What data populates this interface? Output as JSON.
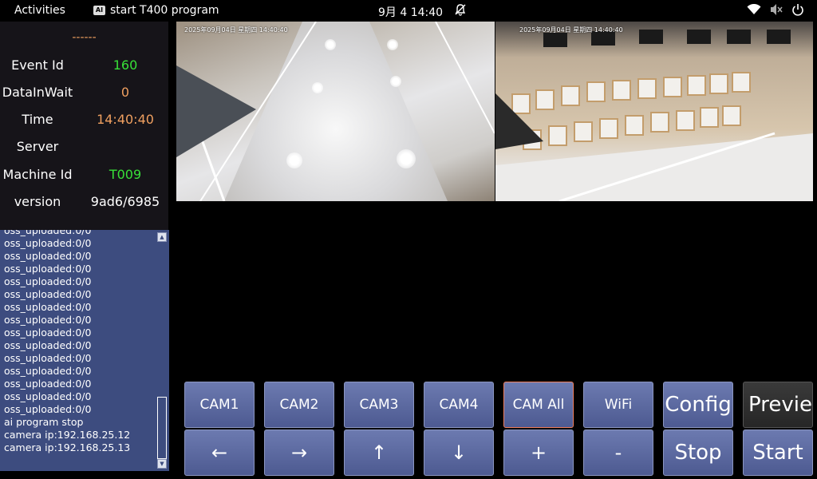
{
  "topbar": {
    "activities": "Activities",
    "app_icon": "AI",
    "app_title": "start T400 program",
    "clock": "9月 4  14:40",
    "tray_icons": [
      "wifi-icon",
      "volume-muted-icon",
      "power-icon"
    ],
    "bell_icon": "bell-muted-icon"
  },
  "info": {
    "dashes": "------",
    "rows": [
      {
        "label": "Event Id",
        "value": "160",
        "color": "#38e038"
      },
      {
        "label": "DataInWait",
        "value": "0",
        "color": "#f0a060"
      },
      {
        "label": "Time",
        "value": "14:40:40",
        "color": "#f0a060"
      },
      {
        "label": "Server",
        "value": "",
        "color": "#ffffff"
      },
      {
        "label": "Machine Id",
        "value": "T009",
        "color": "#38e038"
      },
      {
        "label": "version",
        "value": "9ad6/6985",
        "color": "#ffffff"
      }
    ]
  },
  "log": {
    "lines": [
      "oss_uploaded:0/0",
      "oss_uploaded:0/0",
      "oss_uploaded:0/0",
      "oss_uploaded:0/0",
      "oss_uploaded:0/0",
      "oss_uploaded:0/0",
      "oss_uploaded:0/0",
      "oss_uploaded:0/0",
      "oss_uploaded:0/0",
      "oss_uploaded:0/0",
      "oss_uploaded:0/0",
      "oss_uploaded:0/0",
      "oss_uploaded:0/0",
      "oss_uploaded:0/0",
      "oss_uploaded:0/0",
      "ai program stop",
      "camera ip:192.168.25.12",
      "camera ip:192.168.25.13"
    ],
    "scroll_up": "▲",
    "scroll_down": "▼"
  },
  "cameras": {
    "cam1_stamp": "2025年09月04日 星期四 14:40:40",
    "cam2_stamp": "2025年09月04日 星期四 14:40:40"
  },
  "buttons": {
    "top": [
      "CAM1",
      "CAM2",
      "CAM3",
      "CAM4",
      "CAM All",
      "WiFi",
      "Config",
      "Preview"
    ],
    "bottom": [
      "←",
      "→",
      "↑",
      "↓",
      "+",
      "-",
      "Stop",
      "Start"
    ]
  },
  "colors": {
    "accent_green": "#38e038",
    "accent_orange": "#f0a060",
    "log_bg": "#3d4c7f",
    "button_bg": "#5a68a0",
    "selected_border": "#f08060"
  }
}
